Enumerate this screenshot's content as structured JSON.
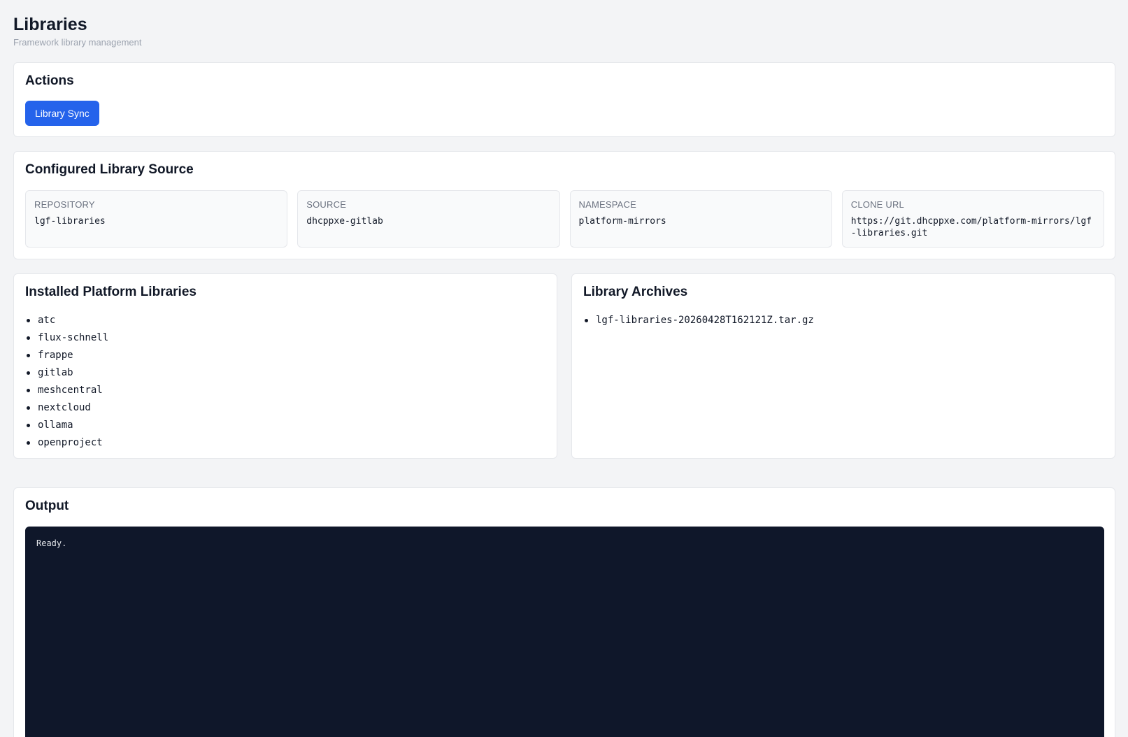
{
  "header": {
    "title": "Libraries",
    "subtitle": "Framework library management"
  },
  "actions": {
    "title": "Actions",
    "sync_label": "Library Sync"
  },
  "source": {
    "title": "Configured Library Source",
    "fields": [
      {
        "label": "REPOSITORY",
        "value": "lgf-libraries"
      },
      {
        "label": "SOURCE",
        "value": "dhcppxe-gitlab"
      },
      {
        "label": "NAMESPACE",
        "value": "platform-mirrors"
      },
      {
        "label": "CLONE URL",
        "value": "https://git.dhcppxe.com/platform-mirrors/lgf-libraries.git"
      }
    ]
  },
  "installed": {
    "title": "Installed Platform Libraries",
    "items": [
      "atc",
      "flux-schnell",
      "frappe",
      "gitlab",
      "meshcentral",
      "nextcloud",
      "ollama",
      "openproject"
    ]
  },
  "archives": {
    "title": "Library Archives",
    "items": [
      "lgf-libraries-20260428T162121Z.tar.gz"
    ]
  },
  "output": {
    "title": "Output",
    "text": "Ready."
  },
  "colors": {
    "background": "#f3f4f6",
    "primary": "#2563eb",
    "terminal": "#0f172a"
  }
}
